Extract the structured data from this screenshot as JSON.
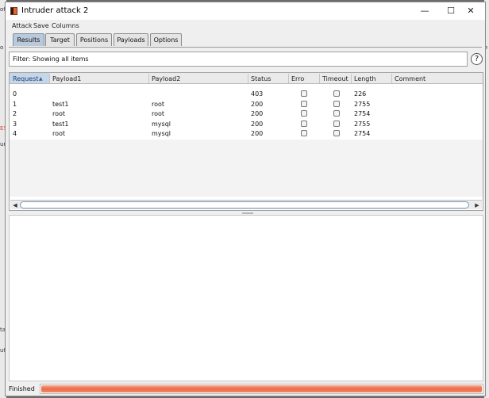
{
  "window": {
    "title": "Intruder attack 2",
    "controls": {
      "minimize": "—",
      "maximize": "☐",
      "close": "✕"
    }
  },
  "menu": [
    "Attack",
    "Save",
    "Columns"
  ],
  "tabs": [
    "Results",
    "Target",
    "Positions",
    "Payloads",
    "Options"
  ],
  "active_tab": "Results",
  "filter": {
    "text": "Filter: Showing all items",
    "help_icon": "?"
  },
  "table": {
    "columns": [
      "Request",
      "Payload1",
      "Payload2",
      "Status",
      "Error",
      "Timeout",
      "Length",
      "Comment"
    ],
    "sorted_column": "Request",
    "sort_direction": "ascending",
    "rows": [
      {
        "request": "0",
        "payload1": "",
        "payload2": "",
        "status": "403",
        "error": false,
        "timeout": false,
        "length": "226",
        "comment": ""
      },
      {
        "request": "1",
        "payload1": "test1",
        "payload2": "root",
        "status": "200",
        "error": false,
        "timeout": false,
        "length": "2755",
        "comment": ""
      },
      {
        "request": "2",
        "payload1": "root",
        "payload2": "root",
        "status": "200",
        "error": false,
        "timeout": false,
        "length": "2754",
        "comment": ""
      },
      {
        "request": "3",
        "payload1": "test1",
        "payload2": "mysql",
        "status": "200",
        "error": false,
        "timeout": false,
        "length": "2755",
        "comment": ""
      },
      {
        "request": "4",
        "payload1": "root",
        "payload2": "mysql",
        "status": "200",
        "error": false,
        "timeout": false,
        "length": "2754",
        "comment": ""
      }
    ]
  },
  "status": {
    "label": "Finished",
    "progress": 1.0,
    "progress_color": "#ef6a45"
  },
  "accent": {
    "selected_header": "#c5d6e8",
    "active_tab": "#b9c9da"
  },
  "background_fragments": [
    "of",
    "o",
    "ES",
    "ur",
    "ta",
    "ut",
    "e"
  ]
}
